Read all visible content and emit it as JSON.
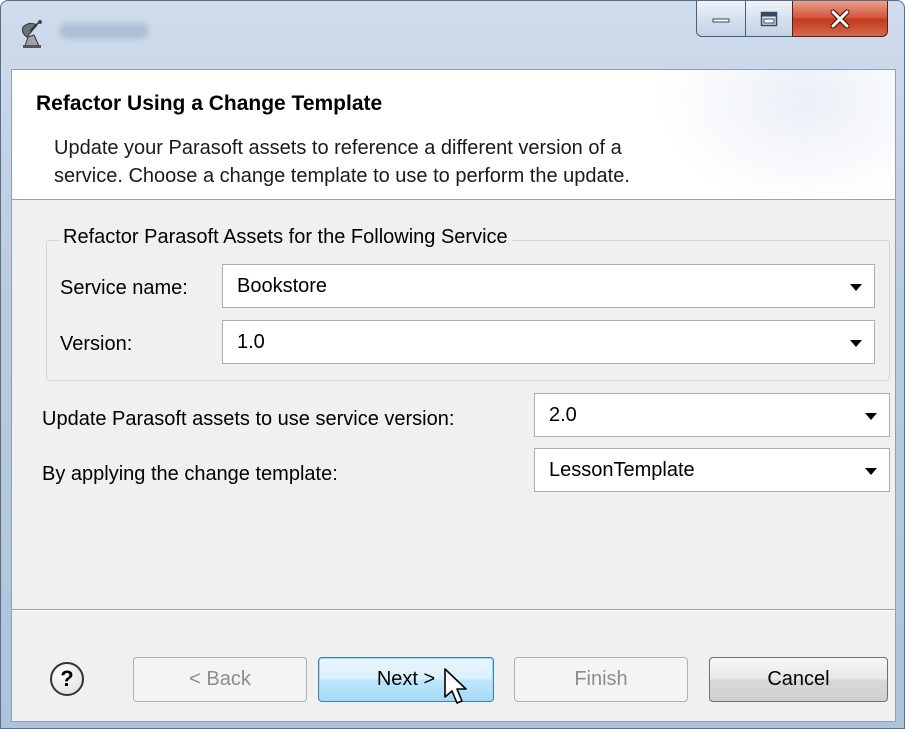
{
  "window": {
    "title": "",
    "controls": {
      "minimize": "minimize",
      "maximize": "maximize",
      "close": "close"
    }
  },
  "banner": {
    "title": "Refactor Using a Change Template",
    "description_line1": "Update your Parasoft assets to reference a different version of a",
    "description_line2": "service.  Choose a change template to use to perform the update."
  },
  "group": {
    "legend": "Refactor Parasoft Assets for the Following Service",
    "service_name_label": "Service name:",
    "service_name_value": "Bookstore",
    "version_label": "Version:",
    "version_value": "1.0"
  },
  "update": {
    "target_version_label": "Update Parasoft assets to use service version:",
    "target_version_value": "2.0",
    "template_label": "By applying the change template:",
    "template_value": "LessonTemplate"
  },
  "footer": {
    "help_glyph": "?",
    "back_label": "< Back",
    "next_label": "Next >",
    "finish_label": "Finish",
    "cancel_label": "Cancel"
  },
  "icons": {
    "app": "satellite-dish-icon",
    "help": "help-icon",
    "cursor": "mouse-pointer-icon"
  },
  "colors": {
    "default_button": "#bee6fd",
    "close_button": "#c23a1c",
    "dialog_background": "#f0f0f0"
  }
}
